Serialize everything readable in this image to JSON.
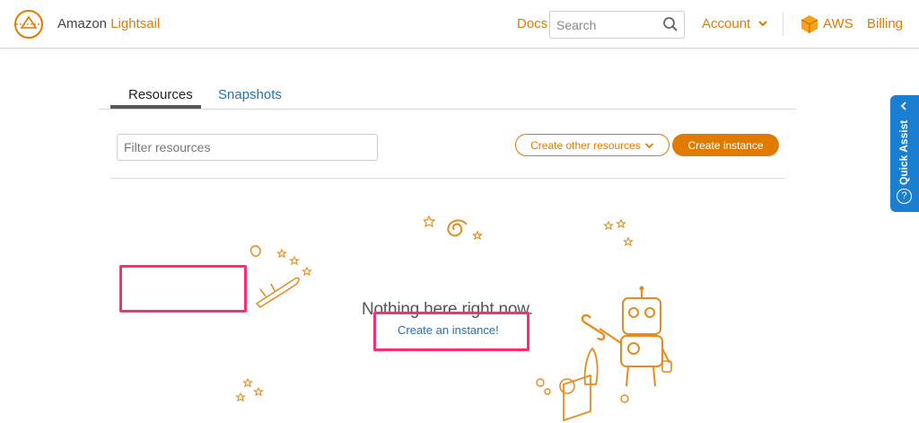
{
  "header": {
    "brand_prefix": "Amazon",
    "brand_name": "Lightsail",
    "docs_label": "Docs",
    "search_placeholder": "Search",
    "account_label": "Account",
    "aws_label": "AWS",
    "billing_label": "Billing"
  },
  "tabs": [
    {
      "label": "Resources",
      "active": true
    },
    {
      "label": "Snapshots",
      "active": false
    }
  ],
  "toolbar": {
    "filter_placeholder": "Filter resources",
    "create_other_label": "Create other resources",
    "create_instance_label": "Create instance"
  },
  "empty_state": {
    "message": "Nothing here right now.",
    "link_label": "Create an instance!"
  },
  "quick_assist": {
    "label": "Quick Assist",
    "help_glyph": "?"
  },
  "colors": {
    "accent": "#e07b00",
    "link": "#1f73b7",
    "highlight": "#ff2d6f",
    "quick_assist_bg": "#1a7fd1"
  }
}
